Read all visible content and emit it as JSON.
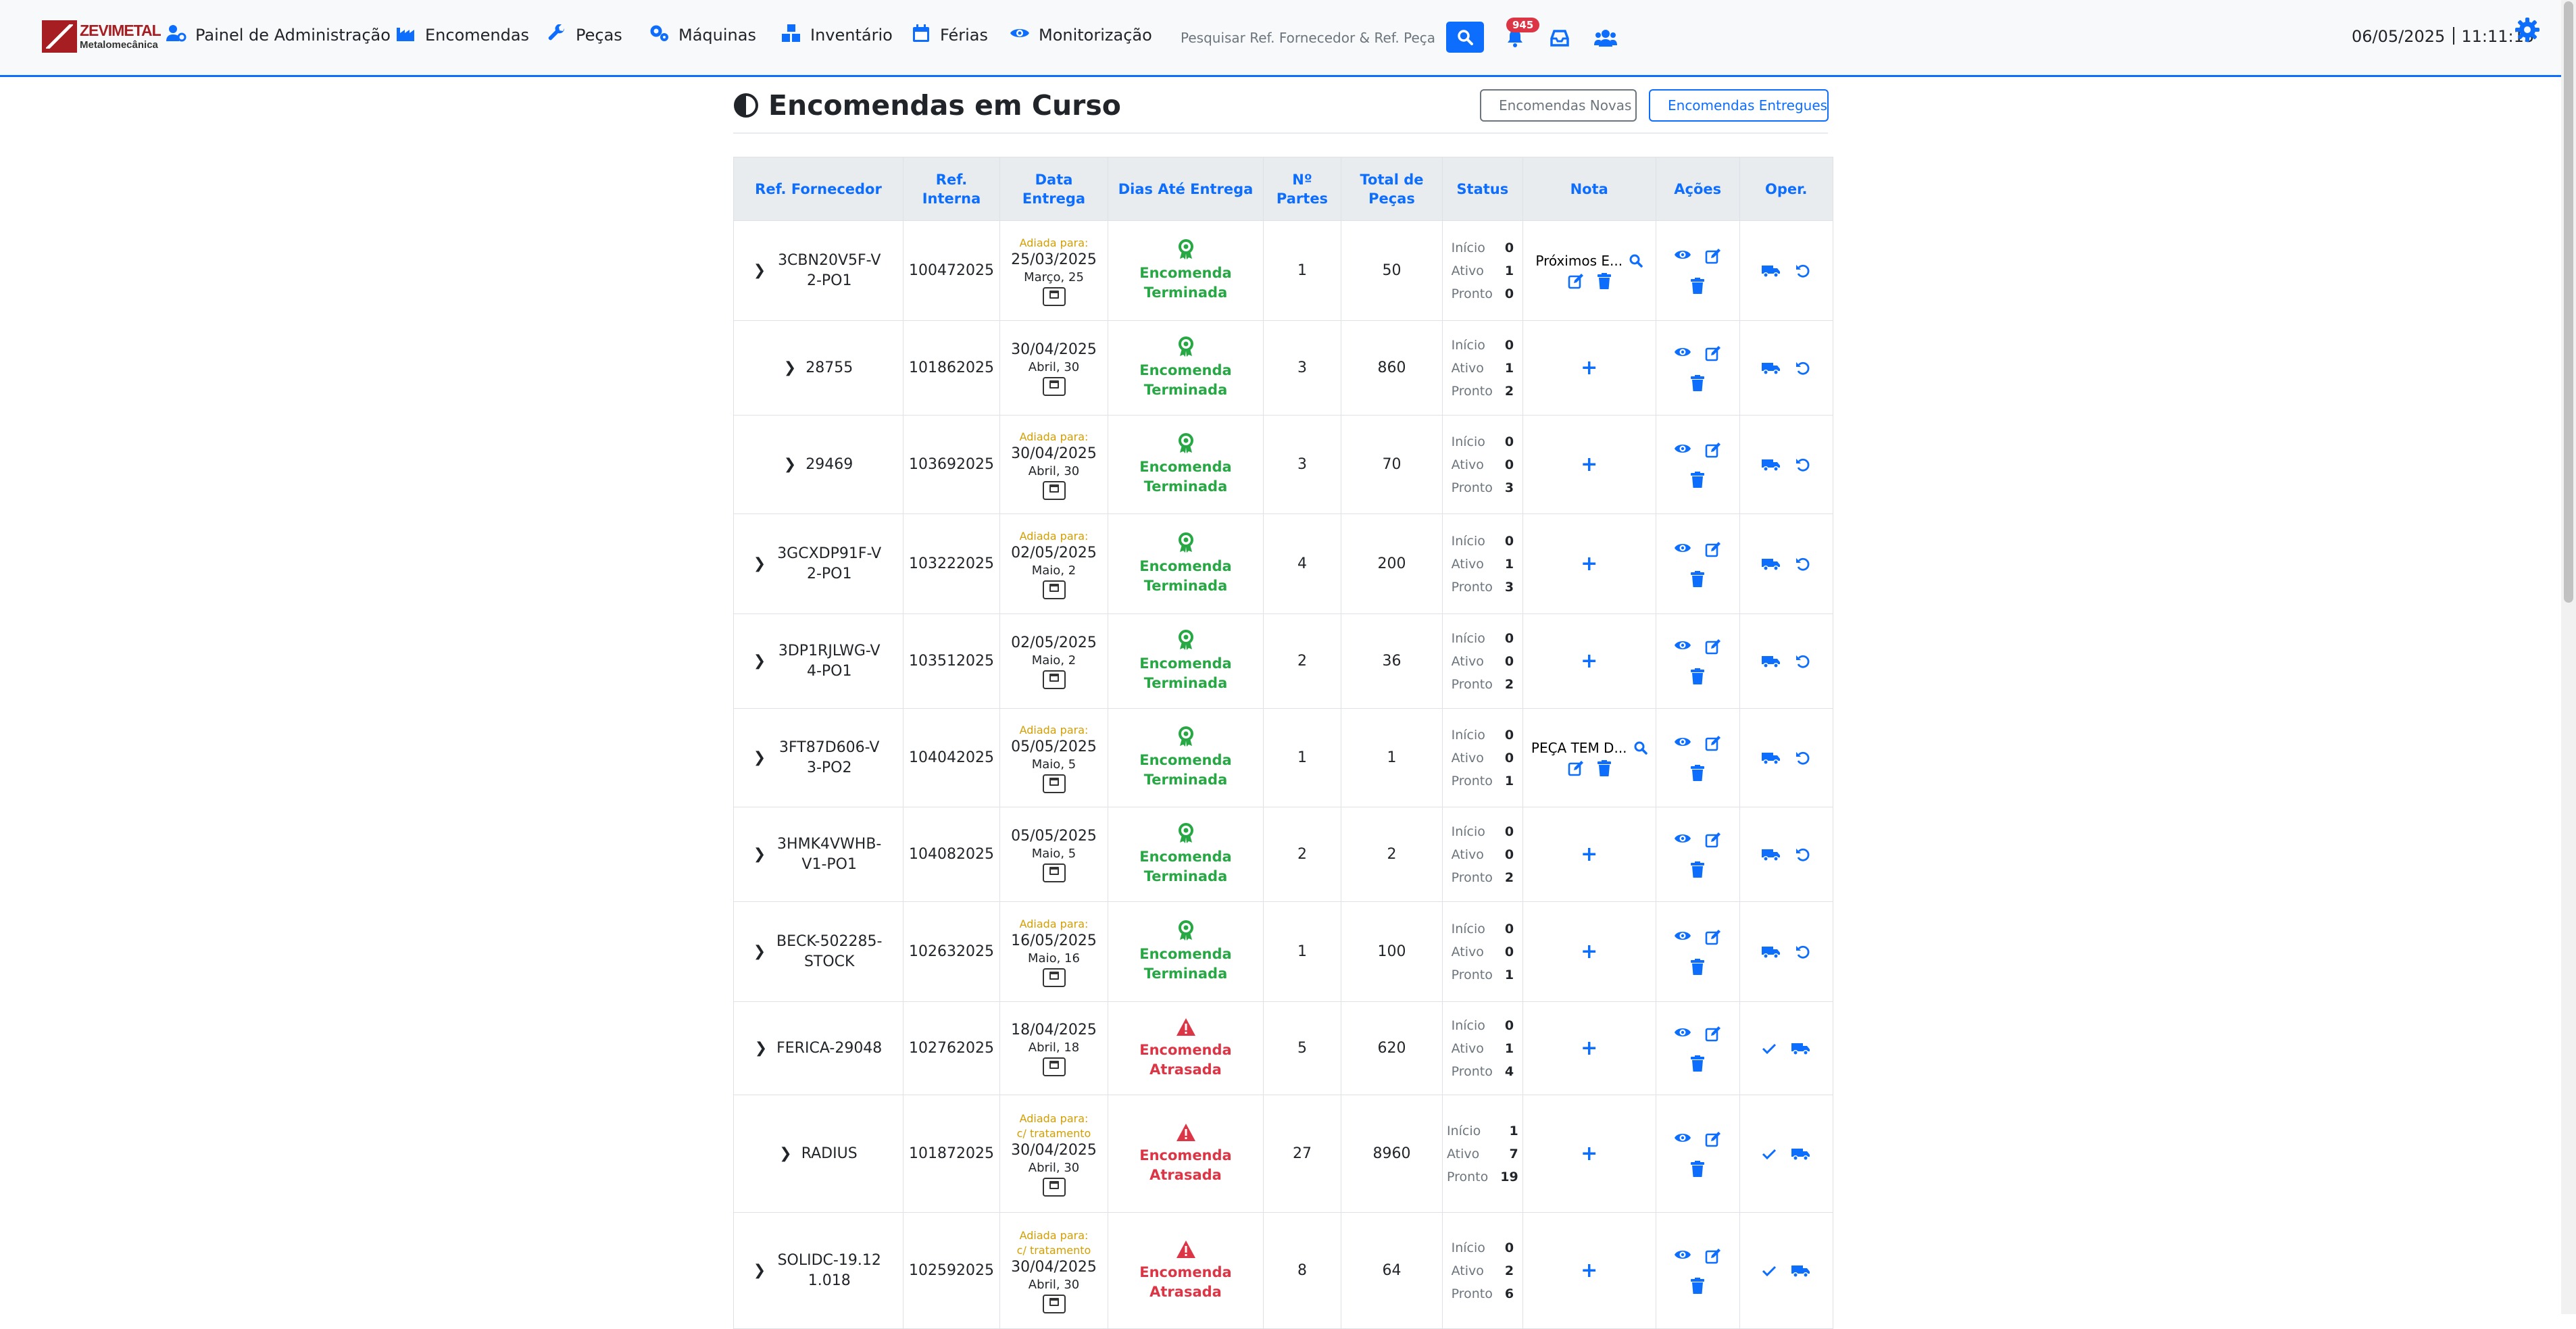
{
  "nav": {
    "logo_name": "ZEVIMETAL",
    "logo_sub": "Metalomecânica",
    "items": [
      {
        "label": "Painel de Administração",
        "icon": "user-gear-icon"
      },
      {
        "label": "Encomendas",
        "icon": "industry-icon"
      },
      {
        "label": "Peças",
        "icon": "wrench-icon"
      },
      {
        "label": "Máquinas",
        "icon": "gears-icon"
      },
      {
        "label": "Inventário",
        "icon": "boxes-icon"
      },
      {
        "label": "Férias",
        "icon": "calendar-icon"
      },
      {
        "label": "Monitorização",
        "icon": "eye-icon"
      }
    ],
    "search_placeholder": "Pesquisar Ref. Fornecedor & Ref. Peça",
    "notification_count": "945",
    "date": "06/05/2025",
    "time": "11:11:15"
  },
  "page": {
    "title": "Encomendas em Curso",
    "btn_novas": "Encomendas Novas",
    "btn_entregues": "Encomendas Entregues"
  },
  "table": {
    "headers": [
      "Ref. Fornecedor",
      "Ref. Interna",
      "Data Entrega",
      "Dias Até Entrega",
      "Nº Partes",
      "Total de Peças",
      "Status",
      "Nota",
      "Ações",
      "Oper."
    ],
    "status_labels": {
      "inicio": "Início",
      "ativo": "Ativo",
      "pronto": "Pronto"
    },
    "rows": [
      {
        "ref": "3CBN20V5F-V2-PO1",
        "interna": "100472025",
        "adiada": [
          "Adiada para:"
        ],
        "date": "25/03/2025",
        "sub": "Março, 25",
        "dias": "Encomenda Terminada",
        "state": "ok",
        "partes": "1",
        "total": "50",
        "inicio": "0",
        "ativo": "1",
        "pronto": "0",
        "note": "Próximos E...",
        "oper": "done"
      },
      {
        "ref": "28755",
        "interna": "101862025",
        "adiada": [],
        "date": "30/04/2025",
        "sub": "Abril, 30",
        "dias": "Encomenda Terminada",
        "state": "ok",
        "partes": "3",
        "total": "860",
        "inicio": "0",
        "ativo": "1",
        "pronto": "2",
        "note": "",
        "oper": "done"
      },
      {
        "ref": "29469",
        "interna": "103692025",
        "adiada": [
          "Adiada para:"
        ],
        "date": "30/04/2025",
        "sub": "Abril, 30",
        "dias": "Encomenda Terminada",
        "state": "ok",
        "partes": "3",
        "total": "70",
        "inicio": "0",
        "ativo": "0",
        "pronto": "3",
        "note": "",
        "oper": "done"
      },
      {
        "ref": "3GCXDP91F-V2-PO1",
        "interna": "103222025",
        "adiada": [
          "Adiada para:"
        ],
        "date": "02/05/2025",
        "sub": "Maio, 2",
        "dias": "Encomenda Terminada",
        "state": "ok",
        "partes": "4",
        "total": "200",
        "inicio": "0",
        "ativo": "1",
        "pronto": "3",
        "note": "",
        "oper": "done"
      },
      {
        "ref": "3DP1RJLWG-V4-PO1",
        "interna": "103512025",
        "adiada": [],
        "date": "02/05/2025",
        "sub": "Maio, 2",
        "dias": "Encomenda Terminada",
        "state": "ok",
        "partes": "2",
        "total": "36",
        "inicio": "0",
        "ativo": "0",
        "pronto": "2",
        "note": "",
        "oper": "done"
      },
      {
        "ref": "3FT87D606-V3-PO2",
        "interna": "104042025",
        "adiada": [
          "Adiada para:"
        ],
        "date": "05/05/2025",
        "sub": "Maio, 5",
        "dias": "Encomenda Terminada",
        "state": "ok",
        "partes": "1",
        "total": "1",
        "inicio": "0",
        "ativo": "0",
        "pronto": "1",
        "note": "PEÇA TEM D...",
        "oper": "done"
      },
      {
        "ref": "3HMK4VWHB-V1-PO1",
        "interna": "104082025",
        "adiada": [],
        "date": "05/05/2025",
        "sub": "Maio, 5",
        "dias": "Encomenda Terminada",
        "state": "ok",
        "partes": "2",
        "total": "2",
        "inicio": "0",
        "ativo": "0",
        "pronto": "2",
        "note": "",
        "oper": "done"
      },
      {
        "ref": "BECK-502285-STOCK",
        "interna": "102632025",
        "adiada": [
          "Adiada para:"
        ],
        "date": "16/05/2025",
        "sub": "Maio, 16",
        "dias": "Encomenda Terminada",
        "state": "ok",
        "partes": "1",
        "total": "100",
        "inicio": "0",
        "ativo": "0",
        "pronto": "1",
        "note": "",
        "oper": "done"
      },
      {
        "ref": "FERICA-29048",
        "interna": "102762025",
        "adiada": [],
        "date": "18/04/2025",
        "sub": "Abril, 18",
        "dias": "Encomenda Atrasada",
        "state": "late",
        "partes": "5",
        "total": "620",
        "inicio": "0",
        "ativo": "1",
        "pronto": "4",
        "note": "",
        "oper": "late"
      },
      {
        "ref": "RADIUS",
        "interna": "101872025",
        "adiada": [
          "Adiada para:",
          "c/ tratamento"
        ],
        "date": "30/04/2025",
        "sub": "Abril, 30",
        "dias": "Encomenda Atrasada",
        "state": "late",
        "partes": "27",
        "total": "8960",
        "inicio": "1",
        "ativo": "7",
        "pronto": "19",
        "note": "",
        "oper": "late"
      },
      {
        "ref": "SOLIDC-19.121.018",
        "interna": "102592025",
        "adiada": [
          "Adiada para:",
          "c/ tratamento"
        ],
        "date": "30/04/2025",
        "sub": "Abril, 30",
        "dias": "Encomenda Atrasada",
        "state": "late",
        "partes": "8",
        "total": "64",
        "inicio": "0",
        "ativo": "2",
        "pronto": "6",
        "note": "",
        "oper": "late"
      }
    ]
  },
  "colors": {
    "primary": "#0d6efd",
    "success": "#28a745",
    "danger": "#dc3545",
    "warning": "#d39e00",
    "brand": "#a61e22"
  }
}
